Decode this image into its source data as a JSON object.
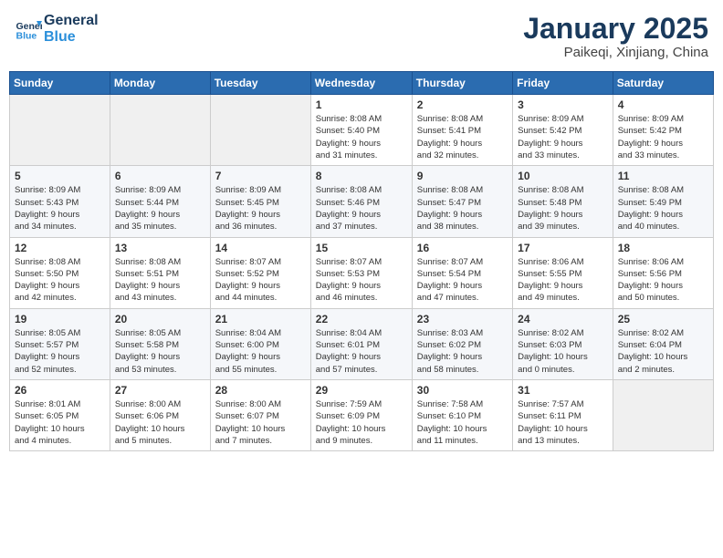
{
  "header": {
    "logo_line1": "General",
    "logo_line2": "Blue",
    "month": "January 2025",
    "location": "Paikeqi, Xinjiang, China"
  },
  "weekdays": [
    "Sunday",
    "Monday",
    "Tuesday",
    "Wednesday",
    "Thursday",
    "Friday",
    "Saturday"
  ],
  "weeks": [
    [
      {
        "day": "",
        "info": ""
      },
      {
        "day": "",
        "info": ""
      },
      {
        "day": "",
        "info": ""
      },
      {
        "day": "1",
        "info": "Sunrise: 8:08 AM\nSunset: 5:40 PM\nDaylight: 9 hours\nand 31 minutes."
      },
      {
        "day": "2",
        "info": "Sunrise: 8:08 AM\nSunset: 5:41 PM\nDaylight: 9 hours\nand 32 minutes."
      },
      {
        "day": "3",
        "info": "Sunrise: 8:09 AM\nSunset: 5:42 PM\nDaylight: 9 hours\nand 33 minutes."
      },
      {
        "day": "4",
        "info": "Sunrise: 8:09 AM\nSunset: 5:42 PM\nDaylight: 9 hours\nand 33 minutes."
      }
    ],
    [
      {
        "day": "5",
        "info": "Sunrise: 8:09 AM\nSunset: 5:43 PM\nDaylight: 9 hours\nand 34 minutes."
      },
      {
        "day": "6",
        "info": "Sunrise: 8:09 AM\nSunset: 5:44 PM\nDaylight: 9 hours\nand 35 minutes."
      },
      {
        "day": "7",
        "info": "Sunrise: 8:09 AM\nSunset: 5:45 PM\nDaylight: 9 hours\nand 36 minutes."
      },
      {
        "day": "8",
        "info": "Sunrise: 8:08 AM\nSunset: 5:46 PM\nDaylight: 9 hours\nand 37 minutes."
      },
      {
        "day": "9",
        "info": "Sunrise: 8:08 AM\nSunset: 5:47 PM\nDaylight: 9 hours\nand 38 minutes."
      },
      {
        "day": "10",
        "info": "Sunrise: 8:08 AM\nSunset: 5:48 PM\nDaylight: 9 hours\nand 39 minutes."
      },
      {
        "day": "11",
        "info": "Sunrise: 8:08 AM\nSunset: 5:49 PM\nDaylight: 9 hours\nand 40 minutes."
      }
    ],
    [
      {
        "day": "12",
        "info": "Sunrise: 8:08 AM\nSunset: 5:50 PM\nDaylight: 9 hours\nand 42 minutes."
      },
      {
        "day": "13",
        "info": "Sunrise: 8:08 AM\nSunset: 5:51 PM\nDaylight: 9 hours\nand 43 minutes."
      },
      {
        "day": "14",
        "info": "Sunrise: 8:07 AM\nSunset: 5:52 PM\nDaylight: 9 hours\nand 44 minutes."
      },
      {
        "day": "15",
        "info": "Sunrise: 8:07 AM\nSunset: 5:53 PM\nDaylight: 9 hours\nand 46 minutes."
      },
      {
        "day": "16",
        "info": "Sunrise: 8:07 AM\nSunset: 5:54 PM\nDaylight: 9 hours\nand 47 minutes."
      },
      {
        "day": "17",
        "info": "Sunrise: 8:06 AM\nSunset: 5:55 PM\nDaylight: 9 hours\nand 49 minutes."
      },
      {
        "day": "18",
        "info": "Sunrise: 8:06 AM\nSunset: 5:56 PM\nDaylight: 9 hours\nand 50 minutes."
      }
    ],
    [
      {
        "day": "19",
        "info": "Sunrise: 8:05 AM\nSunset: 5:57 PM\nDaylight: 9 hours\nand 52 minutes."
      },
      {
        "day": "20",
        "info": "Sunrise: 8:05 AM\nSunset: 5:58 PM\nDaylight: 9 hours\nand 53 minutes."
      },
      {
        "day": "21",
        "info": "Sunrise: 8:04 AM\nSunset: 6:00 PM\nDaylight: 9 hours\nand 55 minutes."
      },
      {
        "day": "22",
        "info": "Sunrise: 8:04 AM\nSunset: 6:01 PM\nDaylight: 9 hours\nand 57 minutes."
      },
      {
        "day": "23",
        "info": "Sunrise: 8:03 AM\nSunset: 6:02 PM\nDaylight: 9 hours\nand 58 minutes."
      },
      {
        "day": "24",
        "info": "Sunrise: 8:02 AM\nSunset: 6:03 PM\nDaylight: 10 hours\nand 0 minutes."
      },
      {
        "day": "25",
        "info": "Sunrise: 8:02 AM\nSunset: 6:04 PM\nDaylight: 10 hours\nand 2 minutes."
      }
    ],
    [
      {
        "day": "26",
        "info": "Sunrise: 8:01 AM\nSunset: 6:05 PM\nDaylight: 10 hours\nand 4 minutes."
      },
      {
        "day": "27",
        "info": "Sunrise: 8:00 AM\nSunset: 6:06 PM\nDaylight: 10 hours\nand 5 minutes."
      },
      {
        "day": "28",
        "info": "Sunrise: 8:00 AM\nSunset: 6:07 PM\nDaylight: 10 hours\nand 7 minutes."
      },
      {
        "day": "29",
        "info": "Sunrise: 7:59 AM\nSunset: 6:09 PM\nDaylight: 10 hours\nand 9 minutes."
      },
      {
        "day": "30",
        "info": "Sunrise: 7:58 AM\nSunset: 6:10 PM\nDaylight: 10 hours\nand 11 minutes."
      },
      {
        "day": "31",
        "info": "Sunrise: 7:57 AM\nSunset: 6:11 PM\nDaylight: 10 hours\nand 13 minutes."
      },
      {
        "day": "",
        "info": ""
      }
    ]
  ]
}
